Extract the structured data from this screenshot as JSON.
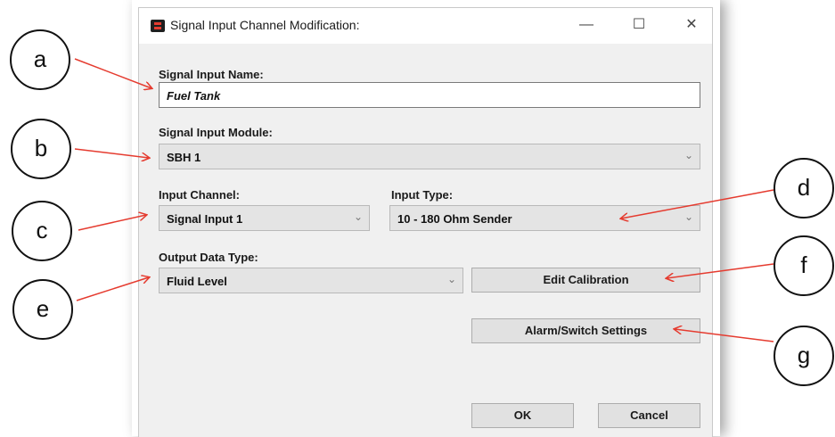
{
  "window": {
    "title": "Signal Input Channel Modification:",
    "minimize_glyph": "—",
    "maximize_glyph": "☐",
    "close_glyph": "✕"
  },
  "fields": {
    "name_label": "Signal Input Name:",
    "name_value": "Fuel Tank",
    "module_label": "Signal Input Module:",
    "module_value": "SBH 1",
    "channel_label": "Input Channel:",
    "channel_value": "Signal Input 1",
    "type_label": "Input Type:",
    "type_value": "10 - 180 Ohm Sender",
    "output_label": "Output Data Type:",
    "output_value": "Fluid Level"
  },
  "buttons": {
    "edit_calibration": "Edit Calibration",
    "alarm_switch": "Alarm/Switch Settings",
    "ok": "OK",
    "cancel": "Cancel"
  },
  "callouts": {
    "a": "a",
    "b": "b",
    "c": "c",
    "d": "d",
    "e": "e",
    "f": "f",
    "g": "g"
  },
  "icons": {
    "chevron": "⌄",
    "app_icon": "app-logo-icon"
  },
  "colors": {
    "arrow": "#e53b2f",
    "dialog_bg": "#f0f0f0"
  }
}
